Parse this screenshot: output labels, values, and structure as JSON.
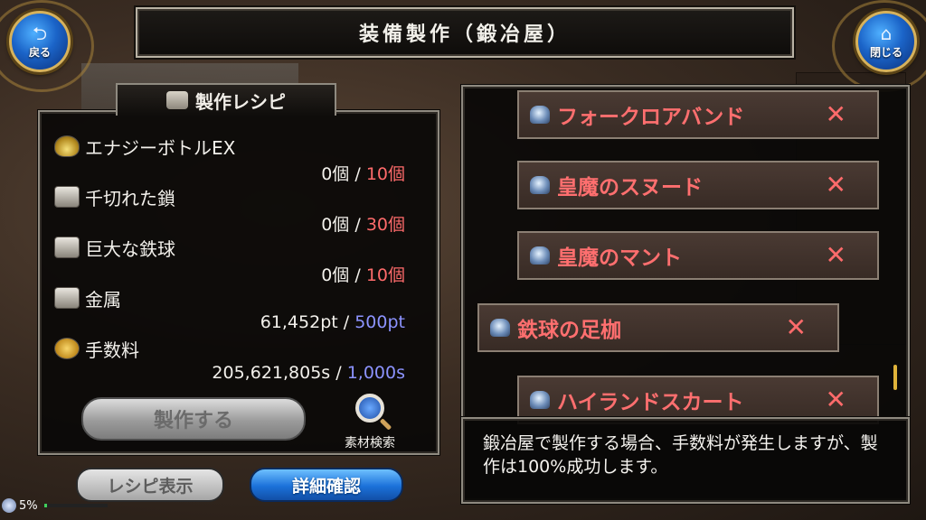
{
  "header": {
    "title": "装備製作（鍛冶屋）"
  },
  "nav": {
    "back_label": "戻る",
    "back_icon": "back-arrow-icon",
    "close_label": "閉じる",
    "close_icon": "home-icon"
  },
  "recipe": {
    "title": "製作レシピ",
    "materials": [
      {
        "name": "エナジーボトルEX",
        "icon": "potion-icon",
        "have": "0個",
        "sep": "/",
        "need": "10個",
        "need_color": "red"
      },
      {
        "name": "千切れた鎖",
        "icon": "ingot-icon",
        "have": "0個",
        "sep": "/",
        "need": "30個",
        "need_color": "red"
      },
      {
        "name": "巨大な鉄球",
        "icon": "ingot-icon",
        "have": "0個",
        "sep": "/",
        "need": "10個",
        "need_color": "red"
      },
      {
        "name": "金属",
        "icon": "ingot-icon",
        "have": "61,452pt",
        "sep": "/",
        "need": "500pt",
        "need_color": "blue"
      },
      {
        "name": "手数料",
        "icon": "coin-icon",
        "have": "205,621,805s",
        "sep": "/",
        "need": "1,000s",
        "need_color": "blue"
      }
    ],
    "craft_label": "製作する",
    "search_label": "素材検索"
  },
  "bottom_buttons": {
    "recipe_display": "レシピ表示",
    "detail_confirm": "詳細確認"
  },
  "status": {
    "percent": "5%"
  },
  "equipment_list": [
    {
      "name": "フォークロアバンド",
      "mark": "✕"
    },
    {
      "name": "皇魔のスヌード",
      "mark": "✕"
    },
    {
      "name": "皇魔のマント",
      "mark": "✕"
    },
    {
      "name": "鉄球の足枷",
      "mark": "✕",
      "selected": true
    },
    {
      "name": "ハイランドスカート",
      "mark": "✕"
    }
  ],
  "message": "鍛冶屋で製作する場合、手数料が発生しますが、製作は100%成功します。",
  "colors": {
    "accent_red": "#ff6b6b",
    "accent_blue": "#8c93ff",
    "button_blue": "#1b71d9"
  }
}
